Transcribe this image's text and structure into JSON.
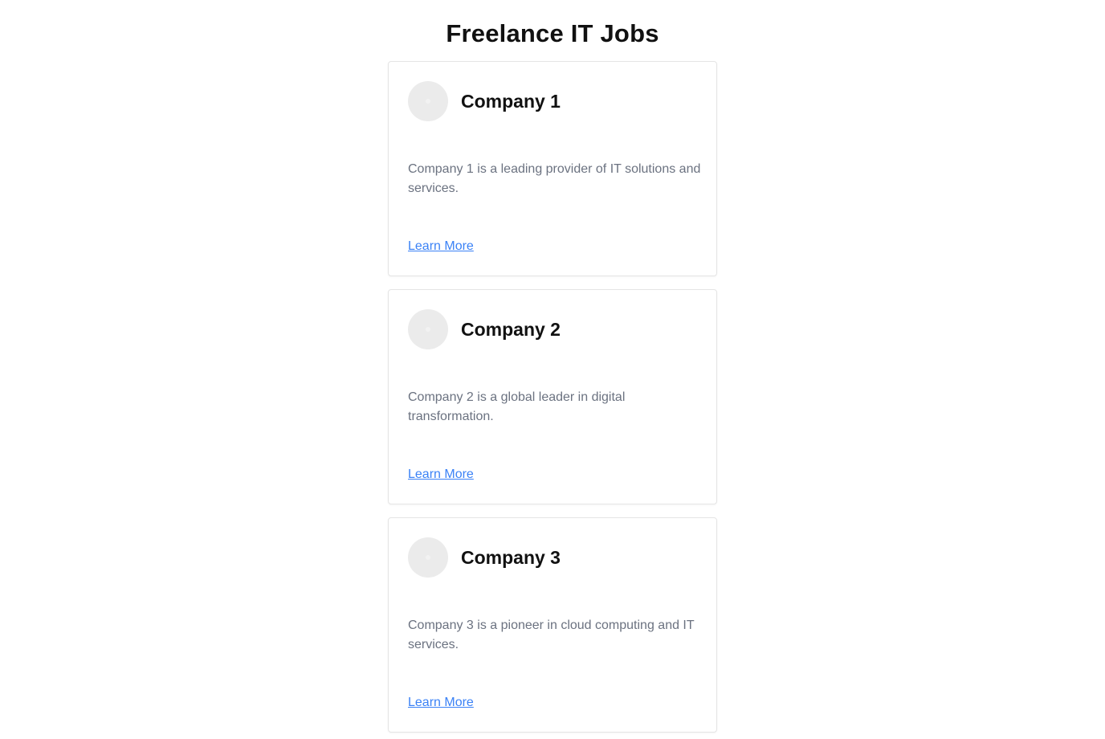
{
  "page": {
    "title": "Freelance IT Jobs"
  },
  "companies": [
    {
      "name": "Company 1",
      "description": "Company 1 is a leading provider of IT solutions and services.",
      "link_label": "Learn More"
    },
    {
      "name": "Company 2",
      "description": "Company 2 is a global leader in digital transformation.",
      "link_label": "Learn More"
    },
    {
      "name": "Company 3",
      "description": "Company 3 is a pioneer in cloud computing and IT services.",
      "link_label": "Learn More"
    }
  ],
  "colors": {
    "link": "#3b82f6",
    "description_text": "#6b7280",
    "logo_placeholder": "#ebebeb",
    "card_border": "#e5e5e5"
  }
}
